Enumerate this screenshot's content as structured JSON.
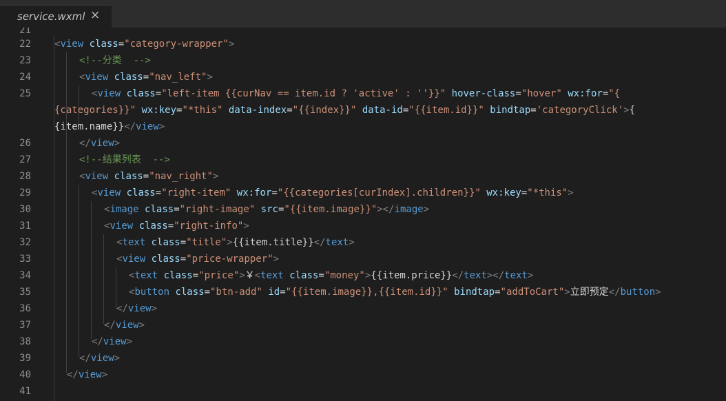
{
  "tab": {
    "filename": "service.wxml",
    "close_glyph": "×"
  },
  "colors": {
    "background": "#1e1e1e",
    "tabbar": "#2d2d2d",
    "tag": "#569cd6",
    "attr": "#9cdcfe",
    "string": "#ce9178",
    "comment": "#6a9955",
    "punct": "#808080",
    "text": "#d4d4d4",
    "line_number": "#8e8e8e"
  },
  "lines": [
    {
      "num": "21",
      "segs": []
    },
    {
      "num": "22",
      "segs": [
        [
          "<",
          "p"
        ],
        [
          "view",
          "g"
        ],
        [
          " ",
          "x"
        ],
        [
          "class",
          "a"
        ],
        [
          "=",
          "e"
        ],
        [
          "\"category-wrapper\"",
          "s"
        ],
        [
          ">",
          "p"
        ]
      ]
    },
    {
      "num": "23",
      "segs": [
        [
          "<!--分类  -->",
          "c"
        ]
      ]
    },
    {
      "num": "24",
      "segs": [
        [
          "<",
          "p"
        ],
        [
          "view",
          "g"
        ],
        [
          " ",
          "x"
        ],
        [
          "class",
          "a"
        ],
        [
          "=",
          "e"
        ],
        [
          "\"nav_left\"",
          "s"
        ],
        [
          ">",
          "p"
        ]
      ]
    },
    {
      "num": "25",
      "segs": [
        [
          "<",
          "p"
        ],
        [
          "view",
          "g"
        ],
        [
          " ",
          "x"
        ],
        [
          "class",
          "a"
        ],
        [
          "=",
          "e"
        ],
        [
          "\"left-item {{curNav == item.id ? 'active' : ''}}\"",
          "s"
        ],
        [
          " ",
          "x"
        ],
        [
          "hover-class",
          "a"
        ],
        [
          "=",
          "e"
        ],
        [
          "\"hover\"",
          "s"
        ],
        [
          " ",
          "x"
        ],
        [
          "wx:for",
          "a"
        ],
        [
          "=",
          "e"
        ],
        [
          "\"{",
          "s"
        ]
      ]
    },
    {
      "num": "",
      "segs": [
        [
          "{categories}}\"",
          "s"
        ],
        [
          " ",
          "x"
        ],
        [
          "wx:key",
          "a"
        ],
        [
          "=",
          "e"
        ],
        [
          "\"*this\"",
          "s"
        ],
        [
          " ",
          "x"
        ],
        [
          "data-index",
          "a"
        ],
        [
          "=",
          "e"
        ],
        [
          "\"{{index}}\"",
          "s"
        ],
        [
          " ",
          "x"
        ],
        [
          "data-id",
          "a"
        ],
        [
          "=",
          "e"
        ],
        [
          "\"{{item.id}}\"",
          "s"
        ],
        [
          " ",
          "x"
        ],
        [
          "bindtap",
          "a"
        ],
        [
          "=",
          "e"
        ],
        [
          "'categoryClick'",
          "s"
        ],
        [
          ">",
          "p"
        ],
        [
          "{",
          "x"
        ]
      ]
    },
    {
      "num": "",
      "segs": [
        [
          "{item.name}}",
          "x"
        ],
        [
          "</",
          "p"
        ],
        [
          "view",
          "g"
        ],
        [
          ">",
          "p"
        ]
      ]
    },
    {
      "num": "26",
      "segs": [
        [
          "</",
          "p"
        ],
        [
          "view",
          "g"
        ],
        [
          ">",
          "p"
        ]
      ]
    },
    {
      "num": "27",
      "segs": [
        [
          "<!--结果列表  -->",
          "c"
        ]
      ]
    },
    {
      "num": "28",
      "segs": [
        [
          "<",
          "p"
        ],
        [
          "view",
          "g"
        ],
        [
          " ",
          "x"
        ],
        [
          "class",
          "a"
        ],
        [
          "=",
          "e"
        ],
        [
          "\"nav_right\"",
          "s"
        ],
        [
          ">",
          "p"
        ]
      ]
    },
    {
      "num": "29",
      "segs": [
        [
          "<",
          "p"
        ],
        [
          "view",
          "g"
        ],
        [
          " ",
          "x"
        ],
        [
          "class",
          "a"
        ],
        [
          "=",
          "e"
        ],
        [
          "\"right-item\"",
          "s"
        ],
        [
          " ",
          "x"
        ],
        [
          "wx:for",
          "a"
        ],
        [
          "=",
          "e"
        ],
        [
          "\"{{categories[curIndex].children}}\"",
          "s"
        ],
        [
          " ",
          "x"
        ],
        [
          "wx:key",
          "a"
        ],
        [
          "=",
          "e"
        ],
        [
          "\"*this\"",
          "s"
        ],
        [
          ">",
          "p"
        ]
      ]
    },
    {
      "num": "30",
      "segs": [
        [
          "<",
          "p"
        ],
        [
          "image",
          "g"
        ],
        [
          " ",
          "x"
        ],
        [
          "class",
          "a"
        ],
        [
          "=",
          "e"
        ],
        [
          "\"right-image\"",
          "s"
        ],
        [
          " ",
          "x"
        ],
        [
          "src",
          "a"
        ],
        [
          "=",
          "e"
        ],
        [
          "\"{{item.image}}\"",
          "s"
        ],
        [
          "></",
          "p"
        ],
        [
          "image",
          "g"
        ],
        [
          ">",
          "p"
        ]
      ]
    },
    {
      "num": "31",
      "segs": [
        [
          "<",
          "p"
        ],
        [
          "view",
          "g"
        ],
        [
          " ",
          "x"
        ],
        [
          "class",
          "a"
        ],
        [
          "=",
          "e"
        ],
        [
          "\"right-info\"",
          "s"
        ],
        [
          ">",
          "p"
        ]
      ]
    },
    {
      "num": "32",
      "segs": [
        [
          "<",
          "p"
        ],
        [
          "text",
          "g"
        ],
        [
          " ",
          "x"
        ],
        [
          "class",
          "a"
        ],
        [
          "=",
          "e"
        ],
        [
          "\"title\"",
          "s"
        ],
        [
          ">",
          "p"
        ],
        [
          "{{item.title}}",
          "x"
        ],
        [
          "</",
          "p"
        ],
        [
          "text",
          "g"
        ],
        [
          ">",
          "p"
        ]
      ]
    },
    {
      "num": "33",
      "segs": [
        [
          "<",
          "p"
        ],
        [
          "view",
          "g"
        ],
        [
          " ",
          "x"
        ],
        [
          "class",
          "a"
        ],
        [
          "=",
          "e"
        ],
        [
          "\"price-wrapper\"",
          "s"
        ],
        [
          ">",
          "p"
        ]
      ]
    },
    {
      "num": "34",
      "segs": [
        [
          "<",
          "p"
        ],
        [
          "text",
          "g"
        ],
        [
          " ",
          "x"
        ],
        [
          "class",
          "a"
        ],
        [
          "=",
          "e"
        ],
        [
          "\"price\"",
          "s"
        ],
        [
          ">",
          "p"
        ],
        [
          "￥",
          "x"
        ],
        [
          "<",
          "p"
        ],
        [
          "text",
          "g"
        ],
        [
          " ",
          "x"
        ],
        [
          "class",
          "a"
        ],
        [
          "=",
          "e"
        ],
        [
          "\"money\"",
          "s"
        ],
        [
          ">",
          "p"
        ],
        [
          "{{item.price}}",
          "x"
        ],
        [
          "</",
          "p"
        ],
        [
          "text",
          "g"
        ],
        [
          "></",
          "p"
        ],
        [
          "text",
          "g"
        ],
        [
          ">",
          "p"
        ]
      ]
    },
    {
      "num": "35",
      "segs": [
        [
          "<",
          "p"
        ],
        [
          "button",
          "g"
        ],
        [
          " ",
          "x"
        ],
        [
          "class",
          "a"
        ],
        [
          "=",
          "e"
        ],
        [
          "\"btn-add\"",
          "s"
        ],
        [
          " ",
          "x"
        ],
        [
          "id",
          "a"
        ],
        [
          "=",
          "e"
        ],
        [
          "\"{{item.image}},{{item.id}}\"",
          "s"
        ],
        [
          " ",
          "x"
        ],
        [
          "bindtap",
          "a"
        ],
        [
          "=",
          "e"
        ],
        [
          "\"addToCart\"",
          "s"
        ],
        [
          ">",
          "p"
        ],
        [
          "立即预定",
          "x"
        ],
        [
          "</",
          "p"
        ],
        [
          "button",
          "g"
        ],
        [
          ">",
          "p"
        ]
      ]
    },
    {
      "num": "36",
      "segs": [
        [
          "</",
          "p"
        ],
        [
          "view",
          "g"
        ],
        [
          ">",
          "p"
        ]
      ]
    },
    {
      "num": "37",
      "segs": [
        [
          "</",
          "p"
        ],
        [
          "view",
          "g"
        ],
        [
          ">",
          "p"
        ]
      ]
    },
    {
      "num": "38",
      "segs": [
        [
          "</",
          "p"
        ],
        [
          "view",
          "g"
        ],
        [
          ">",
          "p"
        ]
      ]
    },
    {
      "num": "39",
      "segs": [
        [
          "</",
          "p"
        ],
        [
          "view",
          "g"
        ],
        [
          ">",
          "p"
        ]
      ]
    },
    {
      "num": "40",
      "segs": [
        [
          "</",
          "p"
        ],
        [
          "view",
          "g"
        ],
        [
          ">",
          "p"
        ]
      ]
    },
    {
      "num": "41",
      "segs": []
    }
  ]
}
